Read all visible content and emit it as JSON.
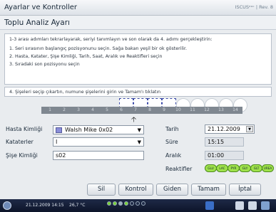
{
  "window": {
    "title": "Ayarlar ve Kontroller",
    "brand": "ISCUSᵉᵒᶜ | Rev. 8"
  },
  "header": {
    "title": "Toplu Analiz Ayarı"
  },
  "instructions": {
    "line1": "1-3 arası adımları tekrarlayarak, seriyi tanımlayın ve son olarak da 4. adımı gerçekleştirin:",
    "line2": "1. Seri sırasının başlangıç pozisyonunu seçin. Sağa bakan yeşil bir ok gösterilir.",
    "line3": "2. Hasta, Katater, Şişe Kimliği, Tarih, Saat, Aralık ve Reaktifleri seçin",
    "line4": "3. Sıradaki son pozisyonu seçin",
    "step4": "4. Şişeleri seçip çıkartın, numune şişelerini girin ve Tamam'ı tıklatın"
  },
  "rack": {
    "numbers": [
      "1",
      "2",
      "3",
      "4",
      "5",
      "6",
      "7",
      "8",
      "9",
      "10",
      "11",
      "12",
      "13",
      "14"
    ]
  },
  "form": {
    "patient_label": "Hasta Kimliği",
    "patient_value": "Walsh Mike 0x02",
    "catheter_label": "Kataterler",
    "catheter_value": "I",
    "vial_label": "Şişe Kimliği",
    "vial_value": "s02",
    "date_label": "Tarih",
    "date_value": "21.12.2009",
    "duration_label": "Süre",
    "duration_value": "15:15",
    "interval_label": "Aralık",
    "interval_value": "01:00",
    "reagents_label": "Reaktifler",
    "reagents": [
      "GLU",
      "LAC",
      "PYR",
      "GLY",
      "GLT",
      "UREA"
    ]
  },
  "buttons": {
    "delete": "Sil",
    "control": "Kontrol",
    "outgoing": "Giden",
    "ok": "Tamam",
    "cancel": "İptal"
  },
  "taskbar": {
    "datetime": "21.12.2009 14:15",
    "temperature": "26,7 °C"
  },
  "colors": {
    "patient_swatch": "#8a8ed8",
    "reagent_badge": "#9fe24a",
    "taskbar": "#1a2440"
  }
}
